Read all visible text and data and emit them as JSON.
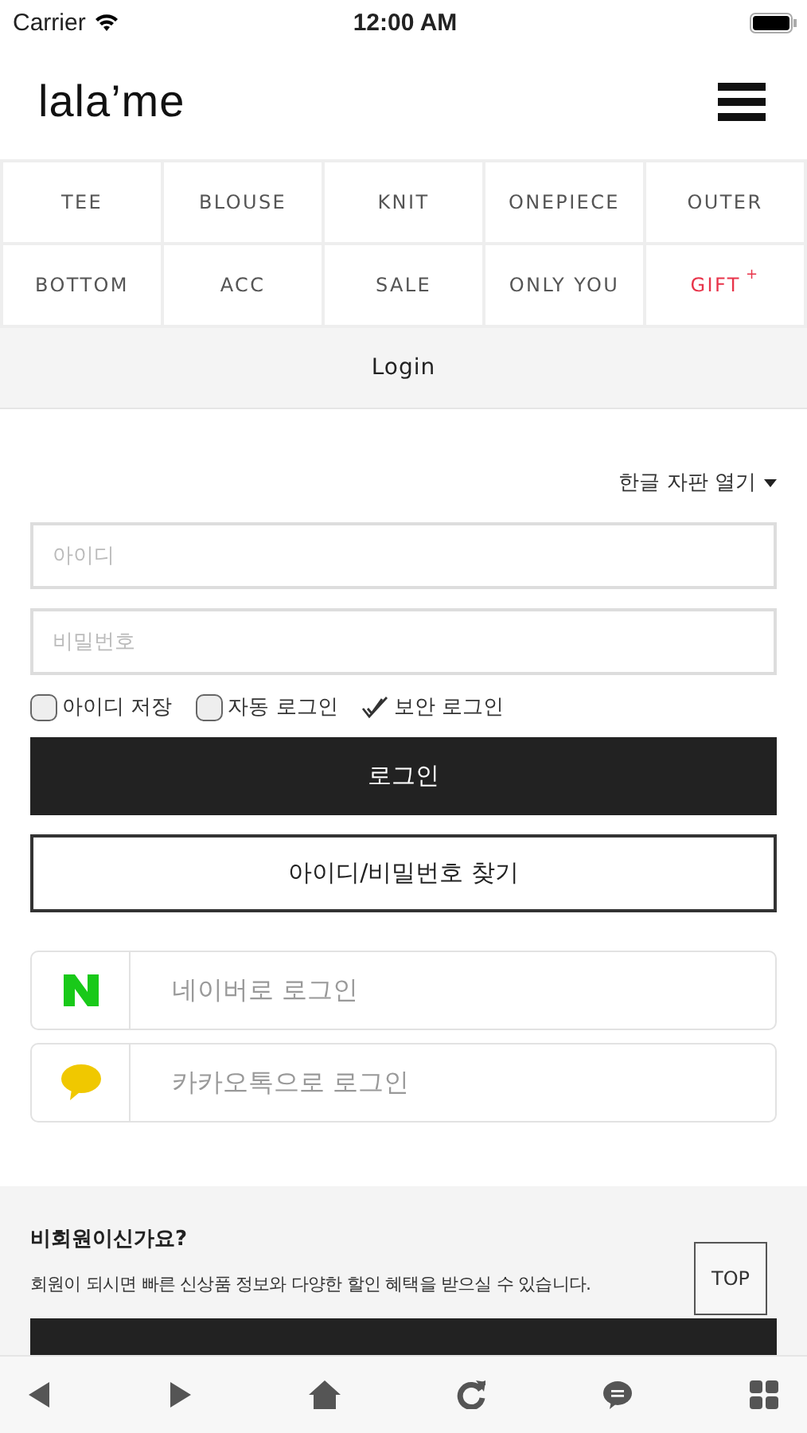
{
  "status_bar": {
    "carrier": "Carrier",
    "time": "12:00 AM"
  },
  "header": {
    "logo": "lala’me"
  },
  "categories": [
    {
      "label": "TEE",
      "highlight": false
    },
    {
      "label": "BLOUSE",
      "highlight": false
    },
    {
      "label": "KNIT",
      "highlight": false
    },
    {
      "label": "ONEPIECE",
      "highlight": false
    },
    {
      "label": "OUTER",
      "highlight": false
    },
    {
      "label": "BOTTOM",
      "highlight": false
    },
    {
      "label": "ACC",
      "highlight": false
    },
    {
      "label": "SALE",
      "highlight": false
    },
    {
      "label": "ONLY YOU",
      "highlight": false
    },
    {
      "label": "GIFT",
      "highlight": true,
      "mark": "+"
    }
  ],
  "page_title": "Login",
  "keyboard_toggle": "한글 자판 열기",
  "fields": [
    {
      "placeholder": "아이디"
    },
    {
      "placeholder": "비밀번호"
    }
  ],
  "options": [
    {
      "label": "아이디 저장",
      "checked": false
    },
    {
      "label": "자동 로그인",
      "checked": false
    },
    {
      "label": "보안 로그인",
      "checked": true
    }
  ],
  "login_button": "로그인",
  "find_button": "아이디/비밀번호 찾기",
  "social": [
    {
      "kind": "naver",
      "label": "네이버로 로그인"
    },
    {
      "kind": "kakao",
      "label": "카카오톡으로 로그인"
    }
  ],
  "join": {
    "title": "비회원이신가요?",
    "text": "회원이 되시면 빠른 신상품 정보와 다양한 할인 혜택을 받으실 수 있습니다."
  },
  "top_button": "TOP"
}
